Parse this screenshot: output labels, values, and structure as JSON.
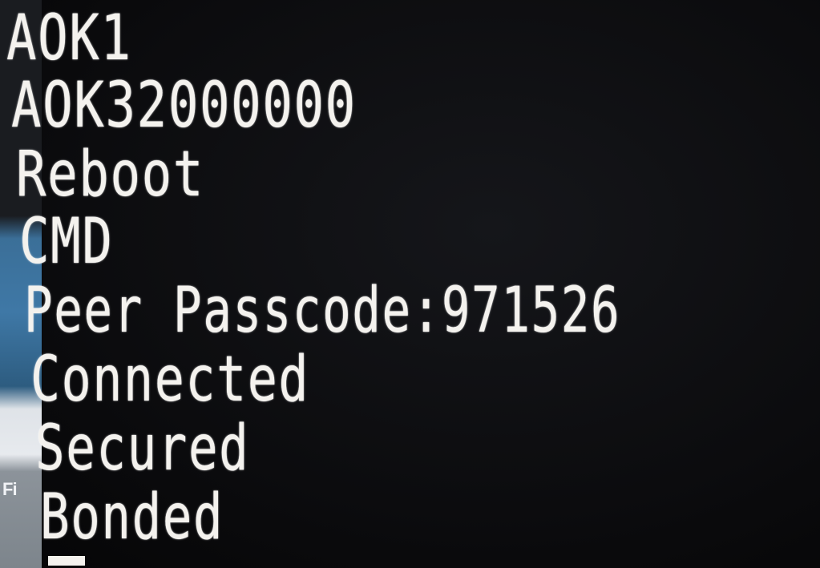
{
  "terminal": {
    "lines": [
      "AOK1",
      "AOK32000000",
      "Reboot",
      "CMD",
      "Peer Passcode:971526",
      "Connected",
      "Secured",
      "Bonded"
    ],
    "text_color": "#f4f2ee",
    "background_color": "#0b0b0d"
  },
  "desktop": {
    "partial_label": "Fi"
  }
}
